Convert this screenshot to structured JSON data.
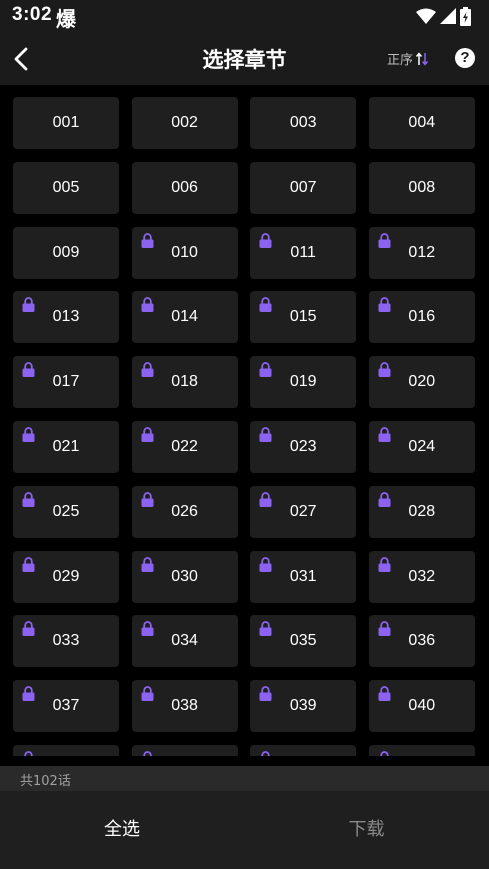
{
  "status_bar": {
    "time": "3:02",
    "app_glyph": "爆",
    "icons": [
      "wifi-icon",
      "signal-icon",
      "battery-icon"
    ]
  },
  "header": {
    "title": "选择章节",
    "sort_label": "正序",
    "sort_icon": "sort-arrows-icon",
    "help_label": "?"
  },
  "chapters": [
    {
      "label": "001",
      "locked": false
    },
    {
      "label": "002",
      "locked": false
    },
    {
      "label": "003",
      "locked": false
    },
    {
      "label": "004",
      "locked": false
    },
    {
      "label": "005",
      "locked": false
    },
    {
      "label": "006",
      "locked": false
    },
    {
      "label": "007",
      "locked": false
    },
    {
      "label": "008",
      "locked": false
    },
    {
      "label": "009",
      "locked": false
    },
    {
      "label": "010",
      "locked": true
    },
    {
      "label": "011",
      "locked": true
    },
    {
      "label": "012",
      "locked": true
    },
    {
      "label": "013",
      "locked": true
    },
    {
      "label": "014",
      "locked": true
    },
    {
      "label": "015",
      "locked": true
    },
    {
      "label": "016",
      "locked": true
    },
    {
      "label": "017",
      "locked": true
    },
    {
      "label": "018",
      "locked": true
    },
    {
      "label": "019",
      "locked": true
    },
    {
      "label": "020",
      "locked": true
    },
    {
      "label": "021",
      "locked": true
    },
    {
      "label": "022",
      "locked": true
    },
    {
      "label": "023",
      "locked": true
    },
    {
      "label": "024",
      "locked": true
    },
    {
      "label": "025",
      "locked": true
    },
    {
      "label": "026",
      "locked": true
    },
    {
      "label": "027",
      "locked": true
    },
    {
      "label": "028",
      "locked": true
    },
    {
      "label": "029",
      "locked": true
    },
    {
      "label": "030",
      "locked": true
    },
    {
      "label": "031",
      "locked": true
    },
    {
      "label": "032",
      "locked": true
    },
    {
      "label": "033",
      "locked": true
    },
    {
      "label": "034",
      "locked": true
    },
    {
      "label": "035",
      "locked": true
    },
    {
      "label": "036",
      "locked": true
    },
    {
      "label": "037",
      "locked": true
    },
    {
      "label": "038",
      "locked": true
    },
    {
      "label": "039",
      "locked": true
    },
    {
      "label": "040",
      "locked": true
    },
    {
      "label": "",
      "locked": true
    },
    {
      "label": "",
      "locked": true
    },
    {
      "label": "",
      "locked": true
    },
    {
      "label": "",
      "locked": true
    }
  ],
  "footer": {
    "total_label": "共102话",
    "select_all_label": "全选",
    "download_label": "下载"
  },
  "colors": {
    "background": "#000000",
    "bar": "#1b1b1b",
    "cell": "#1f1f1f",
    "lock": "#8b63f0",
    "text_primary": "#ffffff",
    "text_disabled": "#8a8a8a"
  }
}
